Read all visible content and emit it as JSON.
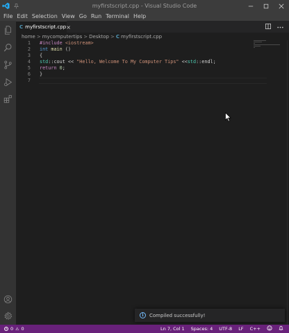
{
  "window": {
    "title": "myfirstscript.cpp - Visual Studio Code",
    "logo_icon": "vscode-logo-icon",
    "pin_icon": "pin-icon",
    "controls": [
      "minimize",
      "maximize",
      "close"
    ]
  },
  "menu": [
    "File",
    "Edit",
    "Selection",
    "View",
    "Go",
    "Run",
    "Terminal",
    "Help"
  ],
  "activity_bar": {
    "top_icons": [
      "files-icon",
      "search-icon",
      "source-control-icon",
      "run-debug-icon",
      "extensions-icon"
    ],
    "bottom_icons": [
      "accounts-icon",
      "settings-gear-icon"
    ]
  },
  "tab": {
    "file_icon_glyph": "C",
    "label": "myfirstscript.cpp",
    "close_glyph": "×"
  },
  "editor_actions": [
    "split-editor-icon",
    "more-actions-icon"
  ],
  "breadcrumb": {
    "parts": [
      "home",
      "mycomputertips",
      "Desktop",
      "myfirstscript.cpp"
    ],
    "separator": ">",
    "file_icon_glyph": "C"
  },
  "code": {
    "line_numbers": [
      "1",
      "2",
      "3",
      "4",
      "5",
      "6",
      "7"
    ],
    "lines": [
      [
        {
          "t": "pp",
          "v": "#include "
        },
        {
          "t": "inc",
          "v": "<iostream>"
        }
      ],
      [
        {
          "t": "kw",
          "v": "int "
        },
        {
          "t": "fn",
          "v": "main"
        },
        {
          "t": "op",
          "v": " ()"
        }
      ],
      [
        {
          "t": "op",
          "v": "{"
        }
      ],
      [
        {
          "t": "ns",
          "v": "std"
        },
        {
          "t": "op",
          "v": "::cout << "
        },
        {
          "t": "str",
          "v": "\"Hello, Welcome To My Computer Tips\""
        },
        {
          "t": "op",
          "v": " <<"
        },
        {
          "t": "ns",
          "v": "std"
        },
        {
          "t": "op",
          "v": "::endl;"
        }
      ],
      [
        {
          "t": "ctrl",
          "v": "return "
        },
        {
          "t": "num",
          "v": "0"
        },
        {
          "t": "op",
          "v": ";"
        }
      ],
      [
        {
          "t": "op",
          "v": "}"
        }
      ],
      []
    ]
  },
  "notification": {
    "icon": "info-icon",
    "icon_glyph": "i",
    "text": "Compiled successfully!"
  },
  "status": {
    "errors": "0",
    "warnings": "0",
    "error_icon_glyph": "×",
    "warning_icon_glyph": "⚠",
    "position": "Ln 7, Col 1",
    "spaces": "Spaces: 4",
    "encoding": "UTF-8",
    "eol": "LF",
    "language": "C++",
    "feedback_icon": "feedback-icon",
    "bell_icon": "bell-icon"
  },
  "colors": {
    "status_bar": "#68217a",
    "title_bar": "#3c3c3c",
    "activity_bar": "#333333",
    "editor_bg": "#1e1e1e",
    "accent_blue": "#519aba"
  }
}
